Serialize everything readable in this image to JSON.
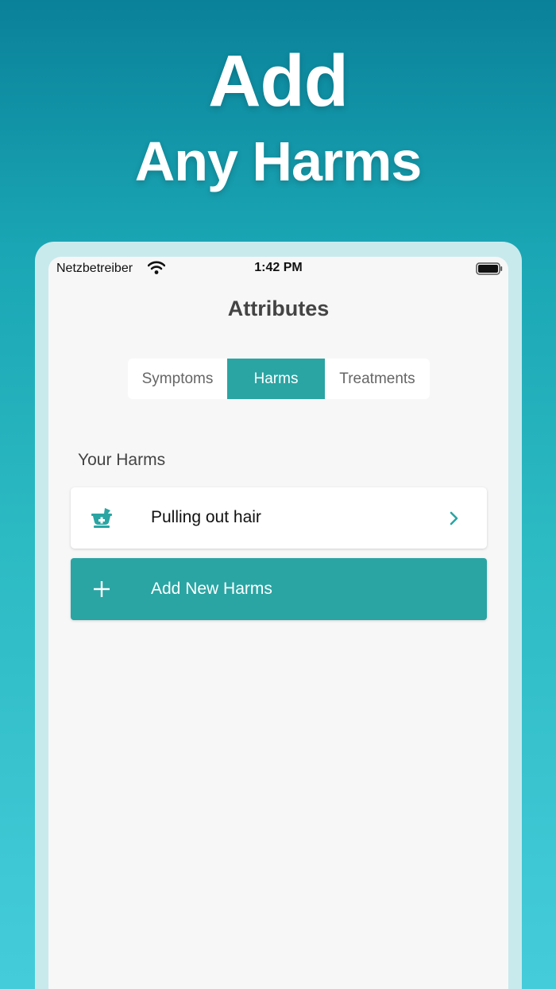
{
  "headline": {
    "line1": "Add",
    "line2": "Any Harms"
  },
  "status_bar": {
    "carrier": "Netzbetreiber",
    "time": "1:42 PM"
  },
  "page": {
    "title": "Attributes"
  },
  "tabs": [
    {
      "label": "Symptoms",
      "selected": false
    },
    {
      "label": "Harms",
      "selected": true
    },
    {
      "label": "Treatments",
      "selected": false
    }
  ],
  "section": {
    "label": "Your Harms"
  },
  "harms": [
    {
      "label": "Pulling out hair",
      "icon": "mortar-pestle-icon"
    }
  ],
  "add_button": {
    "label": "Add New Harms",
    "icon": "plus-icon"
  },
  "colors": {
    "accent": "#2aa5a3",
    "background_top": "#0a8199",
    "background_bottom": "#45ccdb"
  }
}
